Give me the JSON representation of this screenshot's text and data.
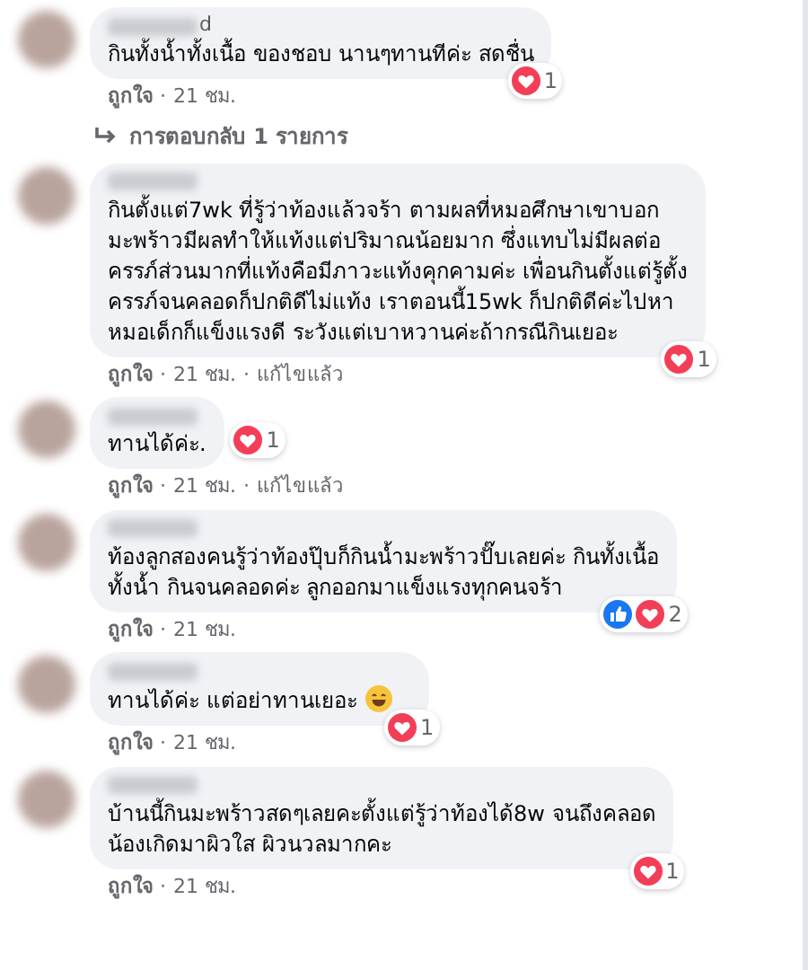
{
  "separator": "·",
  "comments": [
    {
      "name_tail": "d",
      "text": "กินทั้งน้ำทั้งเนื้อ ของชอบ นานๆทานทีค่ะ สดชื่น",
      "trailing_emoji": false,
      "reactions": {
        "icons": [
          {
            "kind": "love"
          }
        ],
        "count": "1"
      },
      "actions": [
        "ถูกใจ",
        "21 ชม."
      ],
      "replies_link": "การตอบกลับ 1 รายการ"
    },
    {
      "text": "กินตั้งแต่7wk ที่รู้ว่าท้องแล้วจร้า ตามผลที่หมอศึกษาเขาบอก\nมะพร้าวมีผลทำให้แท้งแต่ปริมาณน้อยมาก ซึ่งแทบไม่มีผลต่อ\nครรภ์ส่วนมากที่แท้งคือมีภาวะแท้งคุกคามค่ะ เพื่อนกินตั้งแต่รู้ตั้ง\nครรภ์จนคลอดก็ปกติดีไม่แท้ง เราตอนนี้15wk ก็ปกติดีค่ะไปหา\nหมอเด็กก็แข็งแรงดี ระวังแต่เบาหวานค่ะถ้ากรณีกินเยอะ",
      "trailing_emoji": false,
      "reactions": {
        "icons": [
          {
            "kind": "love"
          }
        ],
        "count": "1"
      },
      "actions": [
        "ถูกใจ",
        "21 ชม.",
        "แก้ไขแล้ว"
      ]
    },
    {
      "text": "ทานได้ค่ะ.",
      "trailing_emoji": false,
      "reactions": {
        "icons": [
          {
            "kind": "love"
          }
        ],
        "count": "1"
      },
      "actions": [
        "ถูกใจ",
        "21 ชม.",
        "แก้ไขแล้ว"
      ]
    },
    {
      "text": "ท้องลูกสองคนรู้ว่าท้องปุ๊บก็กินน้ำมะพร้าวปั๊บเลยค่ะ กินทั้งเนื้อ\nทั้งน้ำ กินจนคลอดค่ะ ลูกออกมาแข็งแรงทุกคนจร้า",
      "trailing_emoji": false,
      "reactions": {
        "icons": [
          {
            "kind": "like"
          },
          {
            "kind": "love"
          }
        ],
        "count": "2"
      },
      "actions": [
        "ถูกใจ",
        "21 ชม."
      ]
    },
    {
      "text": "ทานได้ค่ะ แต่อย่าทานเยอะ",
      "trailing_emoji": true,
      "reactions": {
        "icons": [
          {
            "kind": "love"
          }
        ],
        "count": "1"
      },
      "actions": [
        "ถูกใจ",
        "21 ชม."
      ]
    },
    {
      "text": "บ้านนี้กินมะพร้าวสดๆเลยคะตั้งแต่รู้ว่าท้องได้8w จนถึงคลอด\nน้องเกิดมาผิวใส ผิวนวลมากคะ",
      "trailing_emoji": false,
      "reactions": {
        "icons": [
          {
            "kind": "love"
          }
        ],
        "count": "1"
      },
      "actions": [
        "ถูกใจ",
        "21 ชม."
      ]
    }
  ]
}
